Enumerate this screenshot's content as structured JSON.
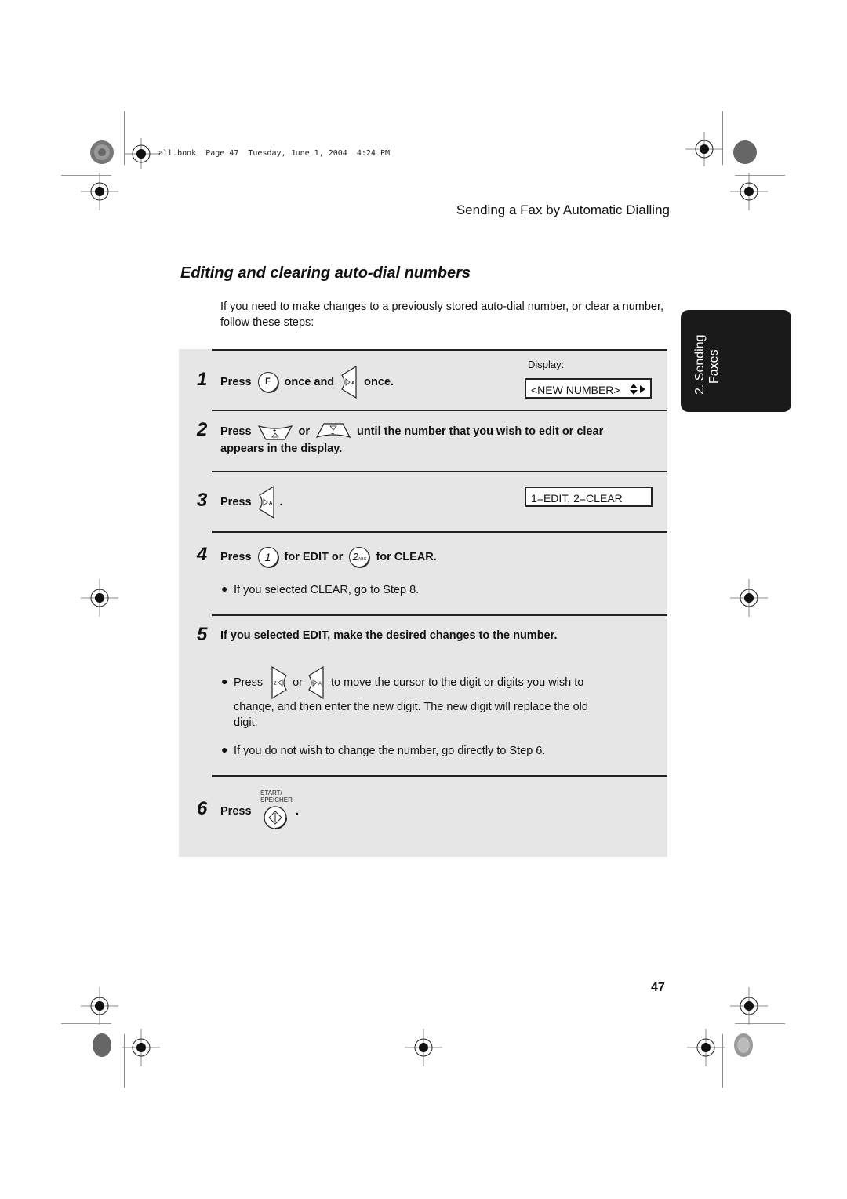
{
  "print_header": {
    "text": "all.book  Page 47  Tuesday, June 1, 2004  4:24 PM"
  },
  "running_head": "Sending a Fax by Automatic Dialling",
  "section_title": "Editing and clearing auto-dial numbers",
  "intro": "If you need to make changes to a previously stored auto-dial number, or clear a number, follow these steps:",
  "side_tab": {
    "line1": "2. Sending",
    "line2": "Faxes",
    "color": "#1a1a1a"
  },
  "display_label": "Display:",
  "steps": [
    {
      "number": "1",
      "press": "Press",
      "key1": "F",
      "mid": "once and",
      "key2_icon": "right-arrow-key-icon",
      "end": "once.",
      "display": "<NEW NUMBER>"
    },
    {
      "number": "2",
      "press": "Press",
      "key1_icon": "up-key-icon",
      "mid": "or",
      "key2_icon": "down-key-icon",
      "end": "until the number that you wish to edit or clear",
      "line2": "appears in the display."
    },
    {
      "number": "3",
      "press": "Press",
      "key_icon": "right-arrow-key-icon",
      "end": ".",
      "display": "1=EDIT, 2=CLEAR"
    },
    {
      "number": "4",
      "press": "Press",
      "key1": "1",
      "mid": "for EDIT or",
      "key2": "2",
      "key2_sub": "ABC",
      "end": "for CLEAR.",
      "bullet": "If you selected CLEAR, go to Step 8."
    },
    {
      "number": "5",
      "text": "If you selected EDIT, make the desired changes to the number.",
      "bullet1_press": "Press",
      "bullet1_or": "or",
      "bullet1_rest": "to move the cursor to the digit or digits you wish to",
      "bullet1_line2": "change, and then enter the new digit. The new digit will replace the old",
      "bullet1_line3": "digit.",
      "bullet2": "If you do not wish to change the number, go directly to Step 6."
    },
    {
      "number": "6",
      "press": "Press",
      "key_label_top": "START/",
      "key_label_bottom": "SPEICHER",
      "end": "."
    }
  ],
  "page_number": "47"
}
